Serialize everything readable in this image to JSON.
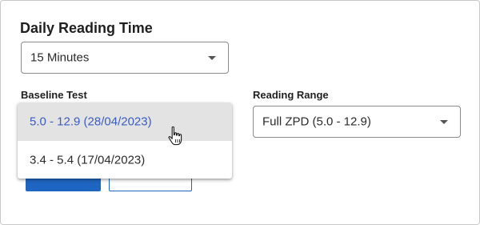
{
  "dialog": {
    "title": "Daily Reading Time",
    "daily_reading_time": {
      "value": "15 Minutes"
    },
    "baseline_test": {
      "label": "Baseline Test",
      "options": [
        {
          "label": "5.0 - 12.9 (28/04/2023)",
          "highlighted": true
        },
        {
          "label": "3.4 - 5.4 (17/04/2023)",
          "highlighted": false
        }
      ]
    },
    "reading_range": {
      "label": "Reading Range",
      "value": "Full ZPD (5.0 - 12.9)"
    }
  },
  "colors": {
    "primary": "#1f66c2",
    "highlight_bg": "#e3e3e3",
    "highlight_text": "#3c5cc0"
  },
  "icons": {
    "select_caret": "caret-down-icon",
    "pointer": "hand-cursor-icon"
  }
}
